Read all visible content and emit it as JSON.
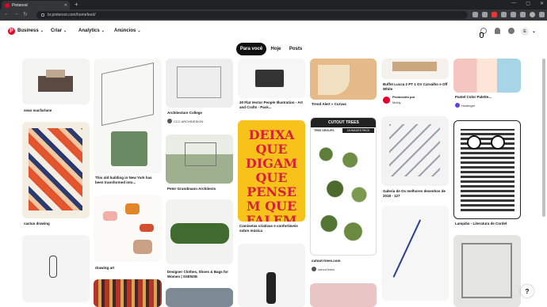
{
  "browser": {
    "tab_title": "Pinterest",
    "url": "br.pinterest.com/homefeed/"
  },
  "header": {
    "menus": [
      "Business",
      "Criar",
      "Analytics",
      "Anúncios"
    ],
    "avatar_letter": "E"
  },
  "subtabs": [
    "Para você",
    "Hoje",
    "Posts"
  ],
  "pins": {
    "c1": [
      {
        "caption": "sean macfarlane"
      },
      {
        "caption": "cactus drawing"
      }
    ],
    "c2": [
      {
        "caption": "This old building in New York has been transformed into..."
      },
      {
        "caption": "drawing art"
      }
    ],
    "c3": [
      {
        "caption": "Architecture College",
        "source": "CCC ARCHIDESIGN"
      },
      {
        "caption": "Peter Grundmann Architects"
      },
      {
        "caption": "Designer Clothes, Shoes & Bags for Women | SSENSE"
      }
    ],
    "c4": [
      {
        "caption": "30 Flat Vector People Illustration - Art and Crafts - Pack..."
      },
      {
        "caption": "Camisetas criativas e confortáveis sobre música"
      }
    ],
    "c5": [
      {
        "caption": "Trend Alert » Curvas"
      },
      {
        "caption": "cutout-trees.com",
        "source": "cutout trees",
        "art_title": "CUTOUT TREES",
        "art_sub": "TREE GROUPS",
        "art_badge": "18 IMAGES PACK"
      }
    ],
    "c6": [
      {
        "caption": "Buffet Lucca 2 PT 1 GV Carvalho e Off White",
        "source": "Promovido por",
        "source2": "Mobly"
      },
      {
        "caption": "Galeria de Os melhores desenhos de 2018 - 127"
      }
    ],
    "c7": [
      {
        "caption": "Pastel Color Palette...",
        "source": "Hostinger"
      },
      {
        "caption": "Lampião - Literatura de Cordel"
      }
    ]
  },
  "poster_text": "DEIXA QUE DIGAM QUE PENSEM QUE FALEM",
  "help_label": "?"
}
